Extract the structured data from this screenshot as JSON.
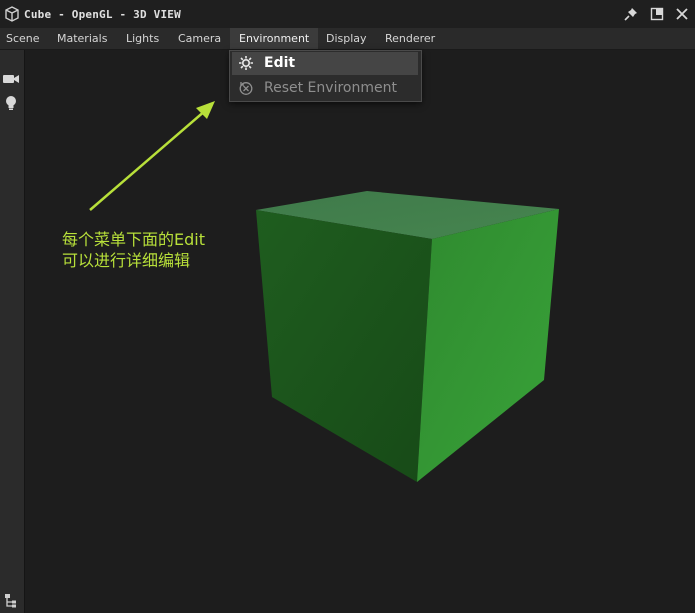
{
  "window": {
    "title": "Cube - OpenGL - 3D VIEW",
    "app_icon": "cube-icon",
    "controls": [
      "pin-icon",
      "maximize-icon",
      "close-icon"
    ]
  },
  "menubar": {
    "items": [
      {
        "label": "Scene"
      },
      {
        "label": "Materials"
      },
      {
        "label": "Lights"
      },
      {
        "label": "Camera"
      },
      {
        "label": "Environment",
        "active": true
      },
      {
        "label": "Display"
      },
      {
        "label": "Renderer"
      }
    ]
  },
  "dropdown": {
    "items": [
      {
        "label": "Edit",
        "icon": "gear-icon",
        "highlighted": true
      },
      {
        "label": "Reset Environment",
        "icon": "reset-icon",
        "disabled": true
      }
    ]
  },
  "toolbar": {
    "tools": [
      "video-camera-icon",
      "light-bulb-icon"
    ],
    "bottom_tool": "hierarchy-icon"
  },
  "viewport": {
    "object": "cube",
    "object_color": "#2e8b2e",
    "background": "#1d1d1d"
  },
  "annotation": {
    "line1": "每个菜单下面的Edit",
    "line2": "可以进行详细编辑",
    "color": "#b8e03a"
  }
}
